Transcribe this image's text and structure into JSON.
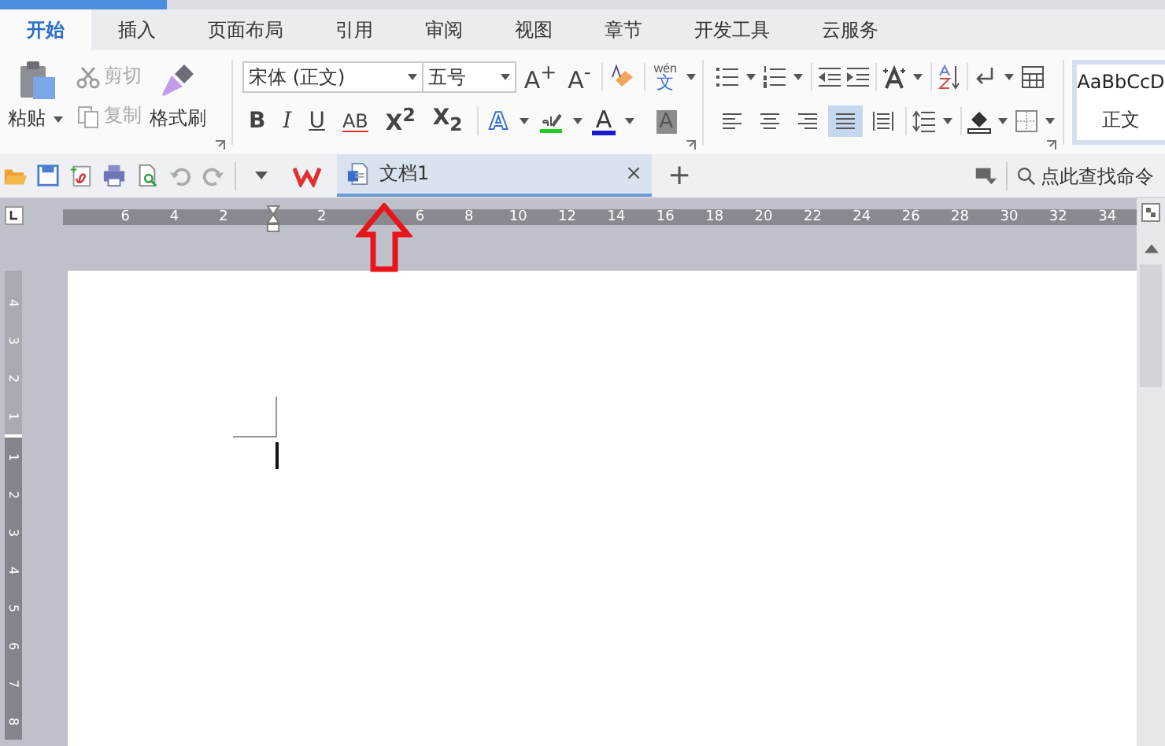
{
  "tabs": [
    {
      "label": "开始",
      "selected": true
    },
    {
      "label": "插入",
      "selected": false
    },
    {
      "label": "页面布局",
      "selected": false
    },
    {
      "label": "引用",
      "selected": false
    },
    {
      "label": "审阅",
      "selected": false
    },
    {
      "label": "视图",
      "selected": false
    },
    {
      "label": "章节",
      "selected": false
    },
    {
      "label": "开发工具",
      "selected": false
    },
    {
      "label": "云服务",
      "selected": false
    }
  ],
  "clipboard": {
    "paste": "粘贴",
    "cut": {
      "label": "剪切",
      "disabled": true
    },
    "copy": {
      "label": "复制",
      "disabled": true
    },
    "format_painter": "格式刷"
  },
  "font": {
    "family": "宋体 (正文)",
    "size": "五号",
    "grow": "A$^{+}$",
    "shrink": "A$^{-}$",
    "phonetic": {
      "pinyin": "wén",
      "char": "文"
    }
  },
  "format_buttons": [
    {
      "kind": "bold",
      "text": "B"
    },
    {
      "kind": "italic",
      "text": "I"
    },
    {
      "kind": "underline",
      "text": "U"
    },
    {
      "kind": "strike",
      "text": "AB"
    },
    {
      "kind": "superscript",
      "text": "X$^{2}$"
    },
    {
      "kind": "subscript",
      "text": "X$_{2}$"
    }
  ],
  "effect_buttons": [
    {
      "kind": "outline",
      "text": "A"
    },
    {
      "kind": "highlight"
    },
    {
      "kind": "font_color",
      "text": "A"
    },
    {
      "kind": "char_shading",
      "text": "A"
    }
  ],
  "alignment": [
    {
      "kind": "left",
      "selected": false
    },
    {
      "kind": "center",
      "selected": false
    },
    {
      "kind": "right",
      "selected": false
    },
    {
      "kind": "justify",
      "selected": true
    },
    {
      "kind": "distributed",
      "selected": false
    }
  ],
  "style_preview": {
    "sample": "AaBbCcD",
    "name": "正文"
  },
  "document_tab": {
    "title": "文档1",
    "close": "×"
  },
  "new_tab": "+",
  "search": {
    "placeholder": "点此查找命令"
  },
  "ruler": {
    "labels_before": [
      "6",
      "4",
      "2"
    ],
    "labels_mid": [
      "2"
    ],
    "labels_after": [
      "6",
      "8",
      "10",
      "12",
      "14",
      "16",
      "18",
      "20",
      "22",
      "24",
      "26",
      "28",
      "30",
      "32",
      "34"
    ]
  },
  "vertical_ruler": {
    "above": [
      "4",
      "3",
      "2",
      "1"
    ],
    "below": [
      "1",
      "2",
      "3",
      "4",
      "5",
      "6",
      "7",
      "8"
    ]
  }
}
